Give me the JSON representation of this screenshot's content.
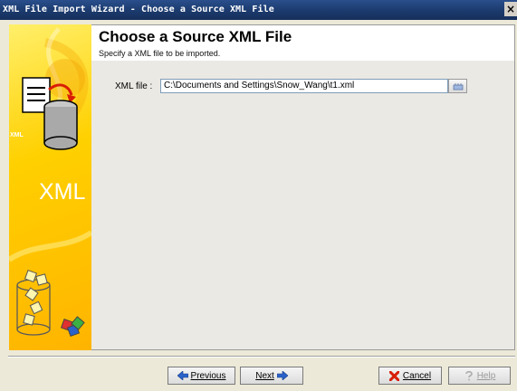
{
  "window": {
    "title": "XML File Import Wizard - Choose a Source XML File",
    "close_glyph": "×"
  },
  "header": {
    "title": "Choose a Source XML File",
    "subtitle": "Specify a XML file to be imported."
  },
  "form": {
    "xml_file_label": "XML file :",
    "xml_file_value": "C:\\Documents and Settings\\Snow_Wang\\t1.xml"
  },
  "sidebar": {
    "xml_badge": "XML",
    "xml_word": "XML"
  },
  "buttons": {
    "previous": "Previous",
    "next": "Next",
    "cancel": "Cancel",
    "help": "Help"
  },
  "icons": {
    "previous": "arrow-left-icon",
    "next": "arrow-right-icon",
    "cancel": "red-x-icon",
    "help": "help-icon",
    "browse": "browse-folder-icon"
  },
  "colors": {
    "titlebar": "#1b3a6d",
    "sidebar": "#ffd000",
    "arrow_blue": "#2a62c9",
    "cancel_red": "#d81e05"
  }
}
